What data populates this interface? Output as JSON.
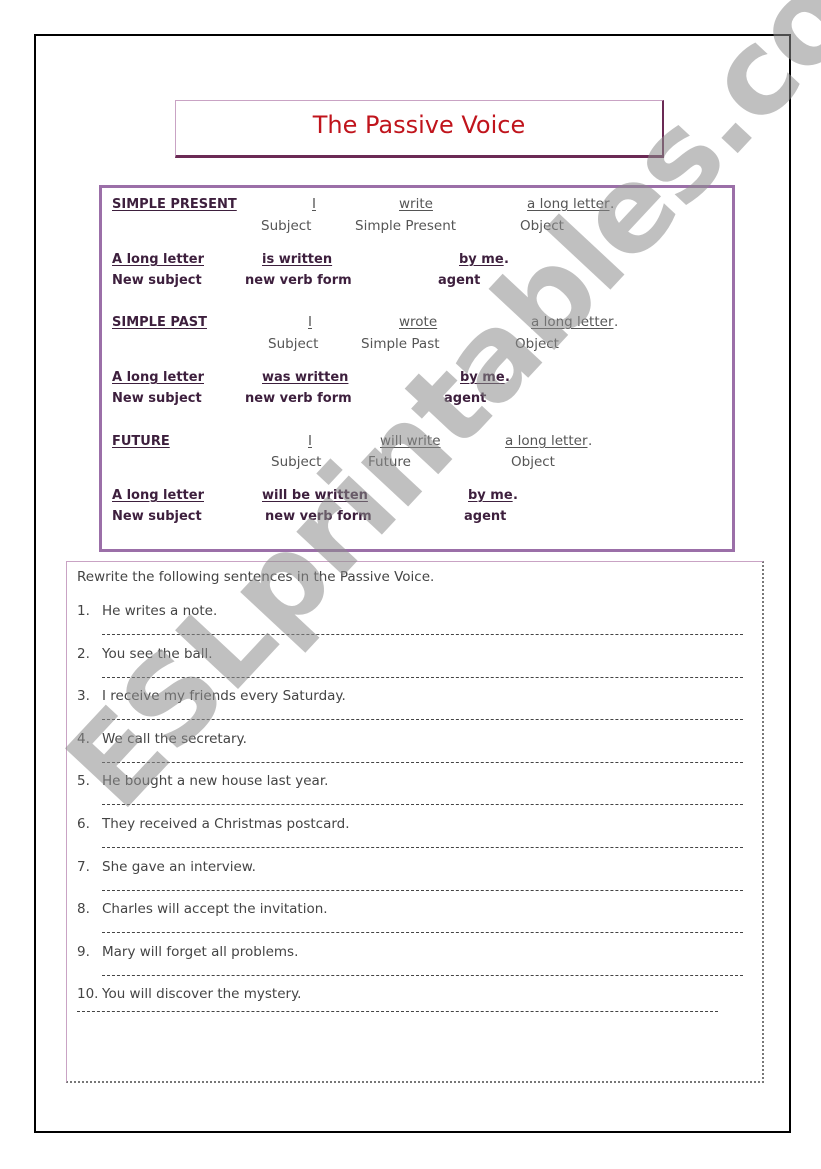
{
  "title": "The Passive Voice",
  "colors": {
    "title": "#c0141c",
    "grammar_border": "#9b6fa8",
    "bold_text": "#3d1f3d"
  },
  "sections": [
    {
      "tense": "SIMPLE PRESENT",
      "active": {
        "subject": "I",
        "verb": "write",
        "object": "a long letter",
        "period": "."
      },
      "active_labels": {
        "subject": "Subject",
        "verb": "Simple Present",
        "object": "Object"
      },
      "passive": {
        "subject": "A long letter",
        "verb": "is written",
        "agent": "by me",
        "period": "."
      },
      "passive_labels": {
        "subject": "New subject",
        "verb": "new verb form",
        "agent": "agent"
      }
    },
    {
      "tense": "SIMPLE PAST",
      "active": {
        "subject": "I",
        "verb": "wrote",
        "object": "a long letter",
        "period": "."
      },
      "active_labels": {
        "subject": "Subject",
        "verb": "Simple Past",
        "object": "Object"
      },
      "passive": {
        "subject": "A long letter",
        "verb": "was written",
        "agent": "by me",
        "period": "."
      },
      "passive_labels": {
        "subject": "New subject",
        "verb": "new verb form",
        "agent": "agent"
      }
    },
    {
      "tense": "FUTURE",
      "active": {
        "subject": "I",
        "verb": "will write",
        "object": "a long letter",
        "period": "."
      },
      "active_labels": {
        "subject": "Subject",
        "verb": "Future",
        "object": "Object"
      },
      "passive": {
        "subject": "A long letter",
        "verb": "will be written",
        "agent": "by me",
        "period": "."
      },
      "passive_labels": {
        "subject": "New subject",
        "verb": "new verb form",
        "agent": "agent"
      }
    }
  ],
  "exercise": {
    "instruction": "Rewrite the following sentences in the Passive Voice.",
    "items": [
      {
        "number": "1.",
        "sentence": "He writes a note."
      },
      {
        "number": "2.",
        "sentence": "You see the ball."
      },
      {
        "number": "3.",
        "sentence": "I receive my friends every Saturday."
      },
      {
        "number": "4.",
        "sentence": "We call the secretary."
      },
      {
        "number": "5.",
        "sentence": "He bought a new house last year."
      },
      {
        "number": "6.",
        "sentence": "They received a Christmas postcard."
      },
      {
        "number": "7.",
        "sentence": "She gave an interview."
      },
      {
        "number": "8.",
        "sentence": "Charles will accept the invitation."
      },
      {
        "number": "9.",
        "sentence": "Mary will forget all problems."
      },
      {
        "number": "10.",
        "sentence": "You will discover the mystery."
      }
    ]
  },
  "watermark": "ESLprintables.com"
}
